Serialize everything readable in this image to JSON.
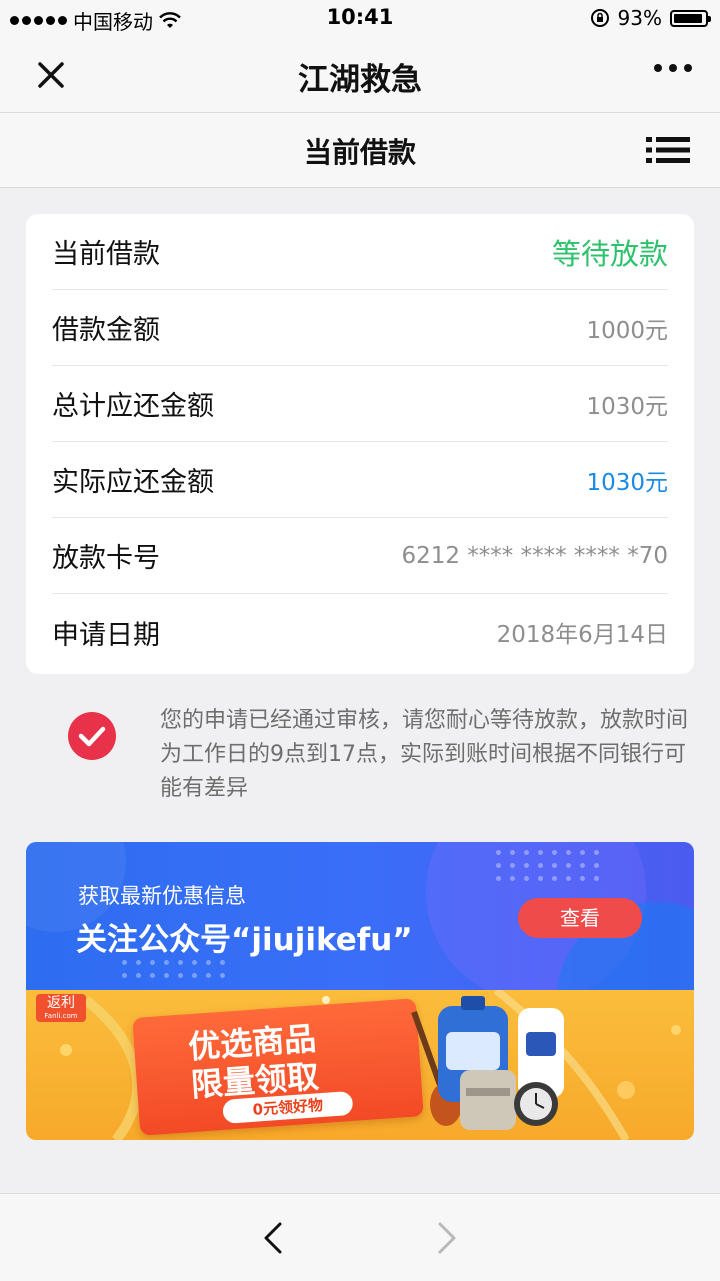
{
  "status_bar": {
    "carrier": "中国移动",
    "time": "10:41",
    "battery_text": "93%",
    "battery_level": 0.93
  },
  "title_bar": {
    "title": "江湖救急",
    "close_icon": "close-icon",
    "more_icon": "more-icon"
  },
  "sub_header": {
    "title": "当前借款",
    "menu_icon": "list-icon"
  },
  "loan": {
    "rows": [
      {
        "label": "当前借款",
        "value": "等待放款"
      },
      {
        "label": "借款金额",
        "value": "1000元"
      },
      {
        "label": "总计应还金额",
        "value": "1030元"
      },
      {
        "label": "实际应还金额",
        "value": "1030元"
      },
      {
        "label": "放款卡号",
        "value": "6212 **** **** **** *70"
      },
      {
        "label": "申请日期",
        "value": "2018年6月14日"
      }
    ],
    "status_color": "#2dc26b",
    "highlight_color": "#1a8ae5"
  },
  "notice": {
    "icon": "check-circle-icon",
    "icon_color": "#e8324a",
    "text": "您的申请已经通过审核，请您耐心等待放款，放款时间为工作日的9点到17点，实际到账时间根据不同银行可能有差异"
  },
  "banner_wechat": {
    "line1": "获取最新优惠信息",
    "line2": "关注公众号“jiujikefu”",
    "button": "查看"
  },
  "banner_promo": {
    "logo": "返利",
    "logo_sub": "Fanli.com",
    "line1": "优选商品",
    "line2": "限量领取",
    "tag": "0元领好物"
  },
  "bottom_nav": {
    "back_icon": "chevron-left-icon",
    "forward_icon": "chevron-right-icon"
  }
}
